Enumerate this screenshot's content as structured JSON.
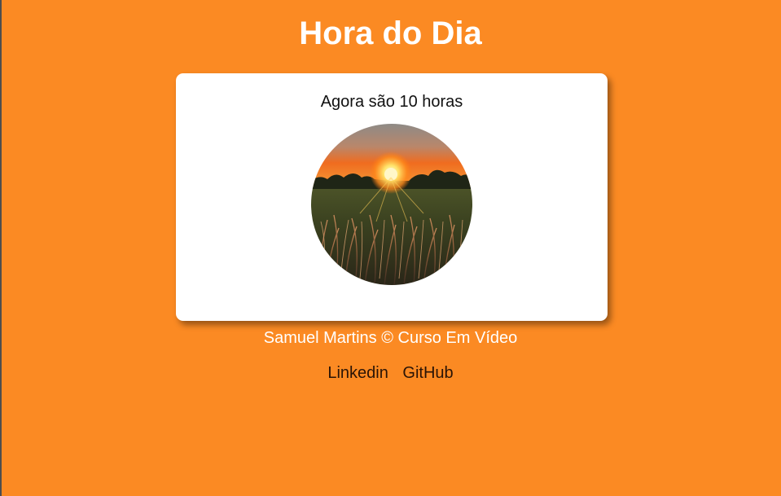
{
  "page": {
    "title": "Hora do Dia",
    "background_color": "#fb8a23"
  },
  "card": {
    "message": "Agora são 10 horas",
    "image_icon": "sunrise-field-photo"
  },
  "footer": {
    "credit": "Samuel Martins © Curso Em Vídeo",
    "links": [
      {
        "label": "Linkedin"
      },
      {
        "label": "GitHub"
      }
    ]
  }
}
